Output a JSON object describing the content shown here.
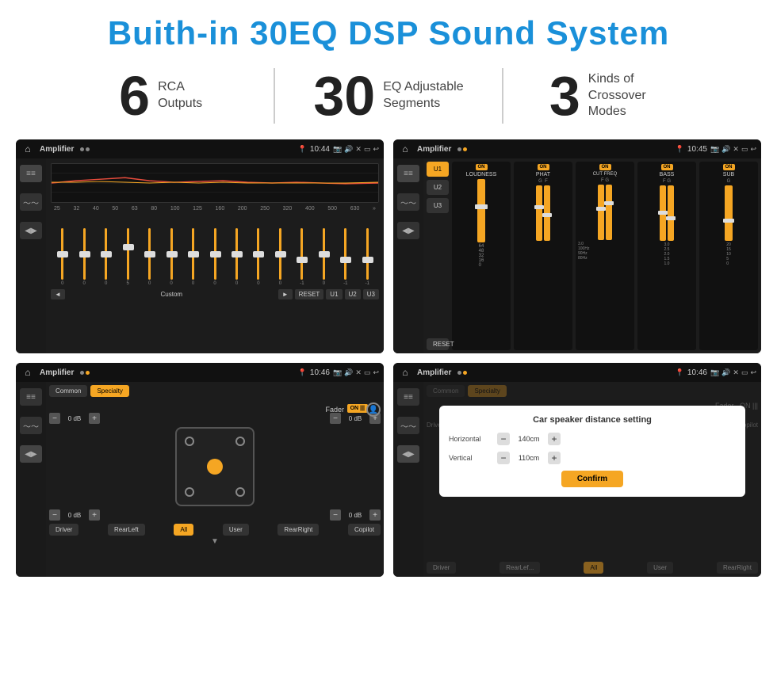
{
  "page": {
    "title": "Buith-in 30EQ DSP Sound System"
  },
  "stats": {
    "items": [
      {
        "number": "6",
        "text": "RCA\nOutputs"
      },
      {
        "number": "30",
        "text": "EQ Adjustable\nSegments"
      },
      {
        "number": "3",
        "text": "Kinds of\nCrossover Modes"
      }
    ]
  },
  "screens": [
    {
      "id": "eq-screen",
      "status_bar": {
        "title": "Amplifier",
        "time": "10:44",
        "mode_dot": "white"
      }
    },
    {
      "id": "crossover-screen",
      "status_bar": {
        "title": "Amplifier",
        "time": "10:45",
        "mode_dot": "orange"
      }
    },
    {
      "id": "fader-screen",
      "status_bar": {
        "title": "Amplifier",
        "time": "10:46",
        "mode_dot": "orange"
      }
    },
    {
      "id": "distance-screen",
      "status_bar": {
        "title": "Amplifier",
        "time": "10:46",
        "mode_dot": "orange"
      },
      "dialog": {
        "title": "Car speaker distance setting",
        "horizontal_label": "Horizontal",
        "horizontal_value": "140cm",
        "vertical_label": "Vertical",
        "vertical_value": "110cm",
        "confirm_label": "Confirm"
      }
    }
  ],
  "eq": {
    "frequencies": [
      "25",
      "32",
      "40",
      "50",
      "63",
      "80",
      "100",
      "125",
      "160",
      "200",
      "250",
      "320",
      "400",
      "500",
      "630"
    ],
    "values": [
      "0",
      "0",
      "0",
      "5",
      "0",
      "0",
      "0",
      "0",
      "0",
      "0",
      "0",
      "-1",
      "0",
      "-1",
      ""
    ],
    "nav_buttons": [
      "◄",
      "Custom",
      "►",
      "RESET",
      "U1",
      "U2",
      "U3"
    ]
  },
  "crossover": {
    "channels": [
      "U1",
      "U2",
      "U3"
    ],
    "sections": [
      {
        "label": "LOUDNESS",
        "on": true
      },
      {
        "label": "PHAT",
        "on": true
      },
      {
        "label": "CUT FREQ",
        "on": true
      },
      {
        "label": "BASS",
        "on": true
      },
      {
        "label": "SUB",
        "on": true
      }
    ],
    "reset_label": "RESET"
  },
  "fader": {
    "tabs": [
      "Common",
      "Specialty"
    ],
    "active_tab": "Specialty",
    "fader_label": "Fader",
    "on_label": "ON",
    "channel_values": [
      "0 dB",
      "0 dB",
      "0 dB",
      "0 dB"
    ],
    "bottom_buttons": [
      "Driver",
      "RearLeft",
      "All",
      "User",
      "RearRight",
      "Copilot"
    ]
  },
  "distance_dialog": {
    "title": "Car speaker distance setting",
    "horizontal_label": "Horizontal",
    "horizontal_value": "140cm",
    "vertical_label": "Vertical",
    "vertical_value": "110cm",
    "confirm_label": "Confirm"
  }
}
